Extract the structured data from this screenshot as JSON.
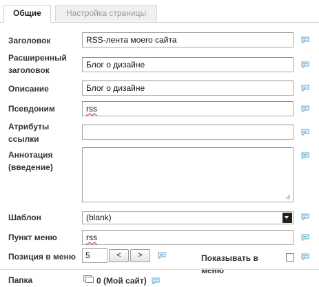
{
  "tabs": [
    {
      "label": "Общие"
    },
    {
      "label": "Настройка страницы"
    }
  ],
  "fields": {
    "title": {
      "label": "Заголовок",
      "value": "RSS-лента моего сайта"
    },
    "extended_title": {
      "label_line1": "Расширенный",
      "label_line2": "заголовок",
      "value": "Блог о дизайне"
    },
    "description": {
      "label": "Описание",
      "value": "Блог о дизайне"
    },
    "alias": {
      "label": "Псевдоним",
      "value": "rss"
    },
    "link_attributes": {
      "label_line1": "Атрибуты",
      "label_line2": "ссылки",
      "value": ""
    },
    "annotation": {
      "label_line1": "Аннотация",
      "label_line2": "(введение)",
      "value": ""
    },
    "template": {
      "label": "Шаблон",
      "selected": "(blank)"
    },
    "menu_item": {
      "label": "Пункт меню",
      "value": "rss"
    },
    "menu_position": {
      "label": "Позиция в меню",
      "value": "5",
      "prev": "<",
      "next": ">"
    },
    "show_in_menu": {
      "label": "Показывать в меню",
      "checked": false
    },
    "folder": {
      "label": "Папка",
      "value": "0 (Мой сайт)"
    }
  },
  "icons": {
    "comment": "speech-bubble-icon",
    "folder": "folder-icon",
    "dropdown": "chevron-down-icon"
  },
  "colors": {
    "comment_icon": "#5aa7d6",
    "tab_border": "#cfcfcf",
    "inactive_tab_text": "#9a9a9a"
  }
}
